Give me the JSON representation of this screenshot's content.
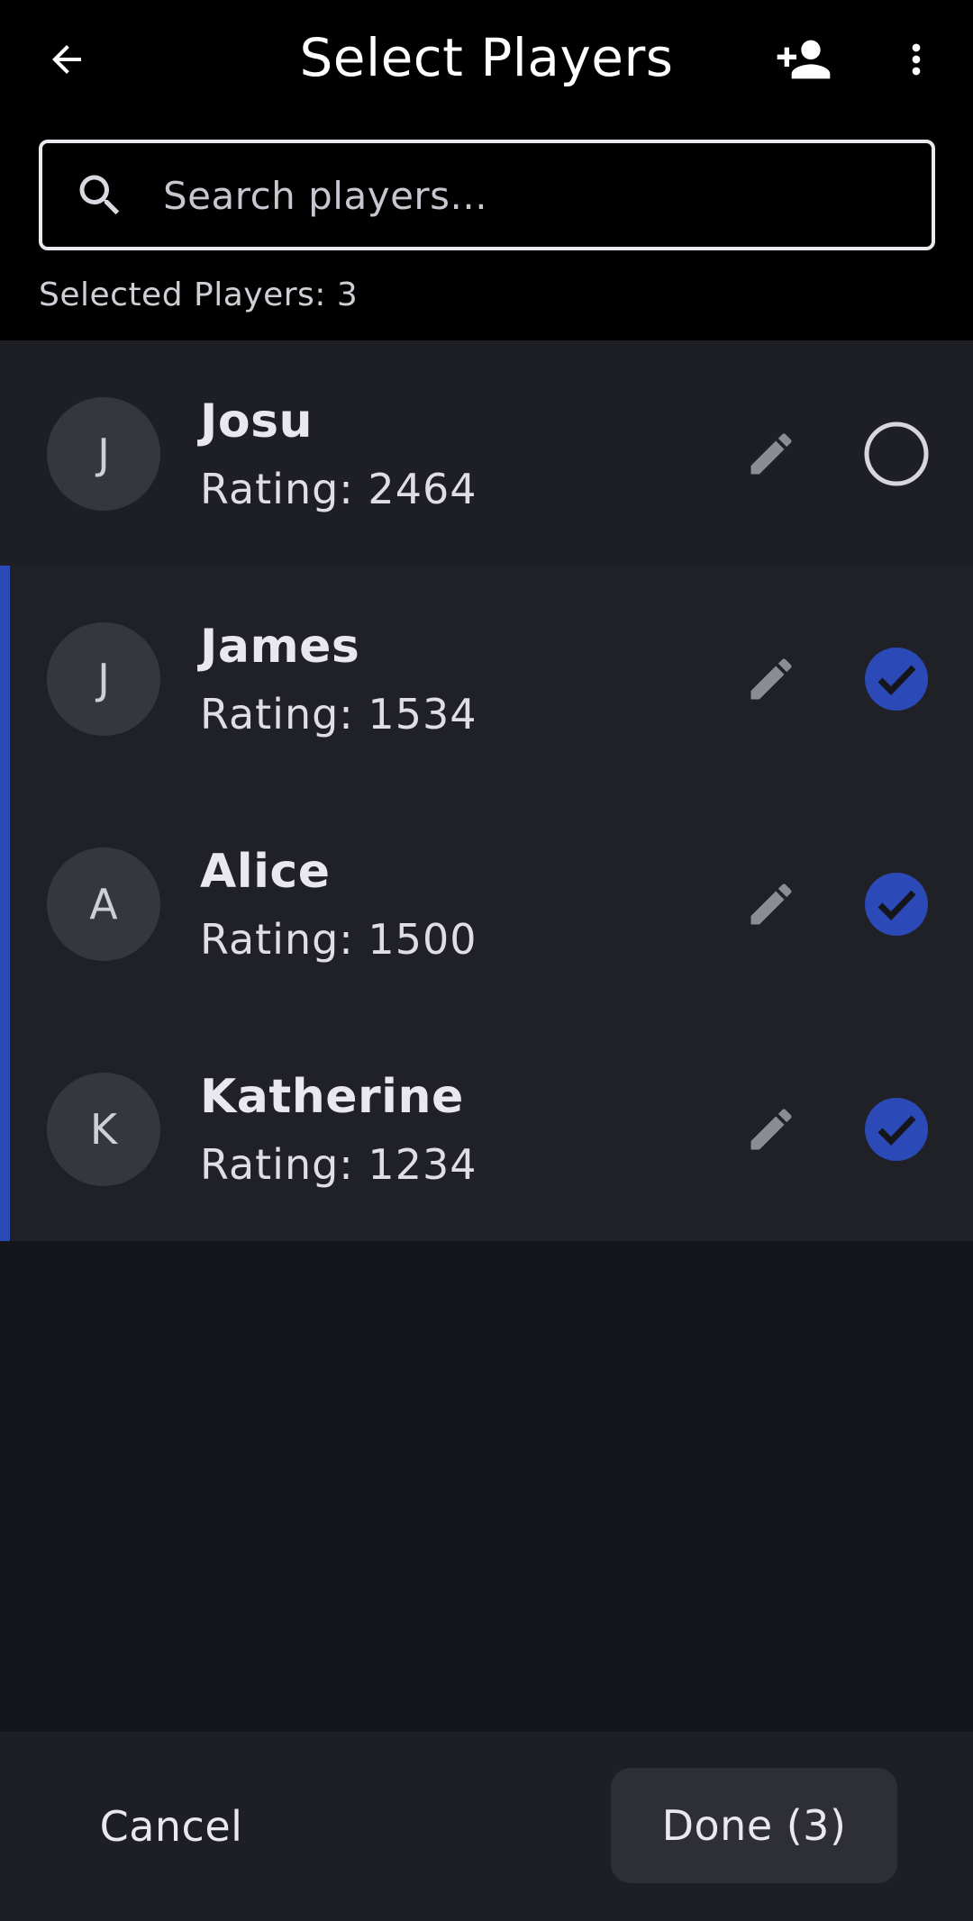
{
  "header": {
    "title": "Select Players",
    "back_icon": "arrow-back-icon",
    "add_icon": "person-add-icon",
    "more_icon": "more-vert-icon"
  },
  "search": {
    "placeholder": "Search players...",
    "value": ""
  },
  "selection": {
    "label": "Selected Players: 3"
  },
  "players": [
    {
      "initial": "J",
      "name": "Josu",
      "rating": "Rating: 2464",
      "selected": false
    },
    {
      "initial": "J",
      "name": "James",
      "rating": "Rating: 1534",
      "selected": true
    },
    {
      "initial": "A",
      "name": "Alice",
      "rating": "Rating: 1500",
      "selected": true
    },
    {
      "initial": "K",
      "name": "Katherine",
      "rating": "Rating: 1234",
      "selected": true
    }
  ],
  "footer": {
    "cancel_label": "Cancel",
    "done_label": "Done (3)"
  },
  "colors": {
    "accent": "#2b4ab8",
    "background": "#15161b",
    "topbar": "#000000",
    "row": "#1e1f25"
  }
}
